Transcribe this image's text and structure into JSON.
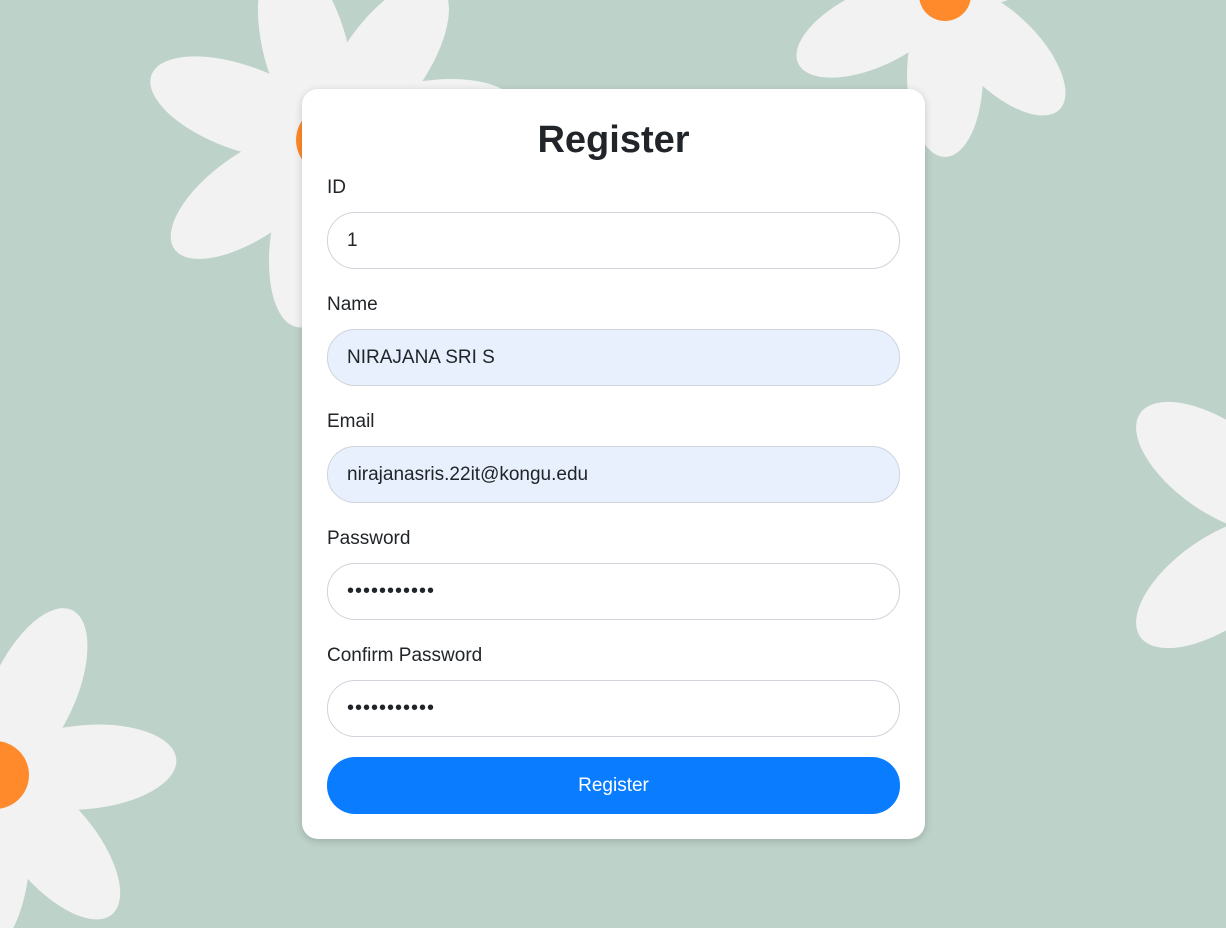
{
  "form": {
    "title": "Register",
    "fields": [
      {
        "label": "ID",
        "value": "1"
      },
      {
        "label": "Name",
        "value": "NIRAJANA SRI S"
      },
      {
        "label": "Email",
        "value": "nirajanasris.22it@kongu.edu"
      },
      {
        "label": "Password",
        "value": "•••••••••••"
      },
      {
        "label": "Confirm Password",
        "value": "•••••••••••"
      }
    ],
    "submit_label": "Register"
  },
  "colors": {
    "background": "#bdd2c9",
    "petal": "#f2f2f2",
    "flower_center": "#ff8a2b",
    "button": "#0a7cff",
    "autofill": "#e8f0fe"
  }
}
